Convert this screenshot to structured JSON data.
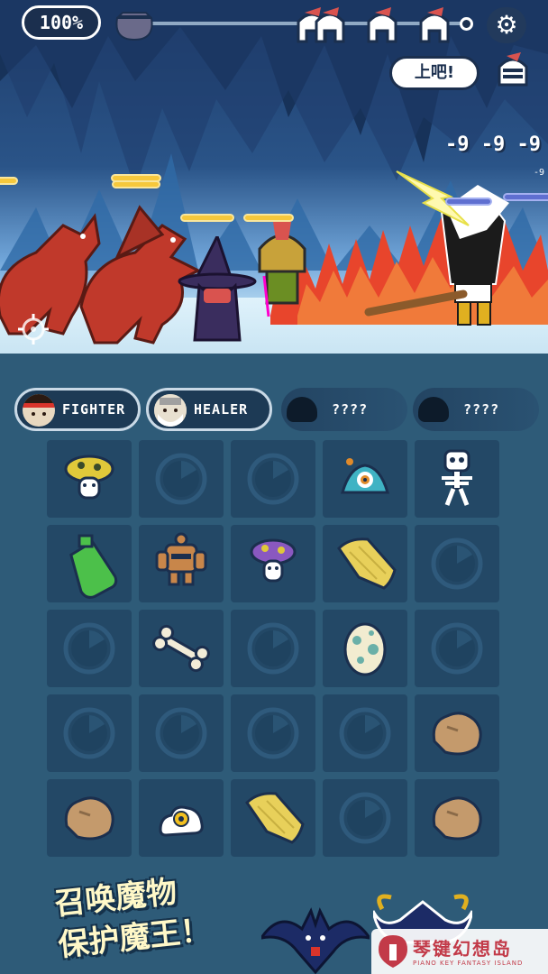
{
  "hud": {
    "progress": "100%",
    "go_label": "上吧!"
  },
  "battle": {
    "damage_numbers": "-9 -9 -9",
    "damage_small": "-9"
  },
  "heroes": [
    {
      "label": "FIGHTER",
      "unlocked": true,
      "icon": "fighter-avatar-icon"
    },
    {
      "label": "HEALER",
      "unlocked": true,
      "icon": "healer-avatar-icon"
    },
    {
      "label": "????",
      "unlocked": false,
      "icon": "locked-avatar-icon"
    },
    {
      "label": "????",
      "unlocked": false,
      "icon": "locked-avatar-icon"
    }
  ],
  "grid": {
    "rows": [
      [
        "yellow-mushroom-monster",
        "cooldown",
        "cooldown",
        "slime-eye-monster",
        "skeleton-monster"
      ],
      [
        "green-potion",
        "golem-monster",
        "purple-mushroom-monster",
        "yellow-cloth",
        "cooldown"
      ],
      [
        "cooldown",
        "bone",
        "cooldown",
        "spotted-egg",
        "cooldown"
      ],
      [
        "cooldown",
        "cooldown",
        "cooldown",
        "cooldown",
        "rock"
      ],
      [
        "rock",
        "fried-egg-eye-monster",
        "yellow-cloth",
        "cooldown",
        "rock"
      ]
    ]
  },
  "promo": {
    "line1": "召唤魔物",
    "line2": "保护魔王！"
  },
  "watermark": {
    "title": "琴键幻想岛",
    "subtitle": "PIANO KEY FANTASY ISLAND"
  },
  "colors": {
    "panel_bg": "#2e5b78",
    "cell_bg": "#234866",
    "hp_ally": "#f6c83c",
    "hp_enemy": "#5f6fd0",
    "fire": "#e8452c"
  }
}
